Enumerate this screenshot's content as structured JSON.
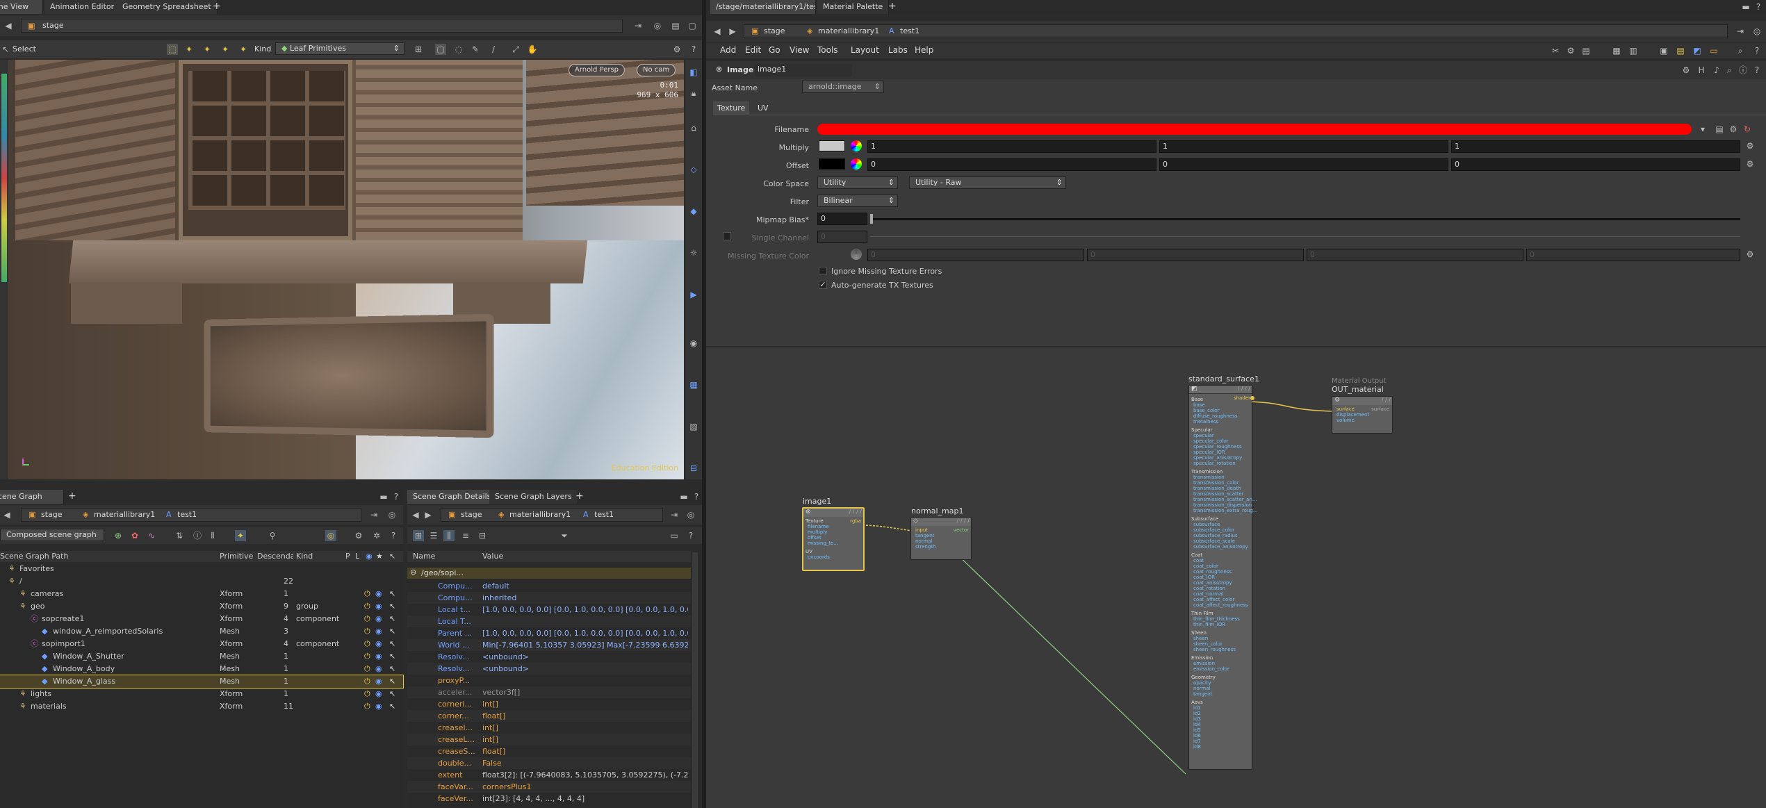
{
  "top_tabs_left": [
    "Scene View",
    "Animation Editor",
    "Geometry Spreadsheet"
  ],
  "top_tabs_right": [
    "/stage/materiallibrary1/test1",
    "Material Palette"
  ],
  "viewer": {
    "path": "stage",
    "tool_label": "Select",
    "kind_label": "Kind",
    "kind_value": "Leaf Primitives",
    "renderer": "Arnold Persp",
    "camera": "No cam",
    "time": "0:01",
    "resolution": "969 x 606",
    "watermark": "Education Edition"
  },
  "scene_tree": {
    "tab": "Scene Graph Tree",
    "breadcrumbs": [
      "stage",
      "materiallibrary1",
      "test1"
    ],
    "mode": "Composed scene graph",
    "columns": [
      "Scene Graph Path",
      "Primitive",
      "Descendants",
      "Kind",
      "P",
      "L",
      "V",
      "S"
    ],
    "rows": [
      {
        "name": "Favorites",
        "prim": "",
        "desc": "",
        "kind": "",
        "indent": 0
      },
      {
        "name": "/",
        "prim": "",
        "desc": "22",
        "kind": "",
        "indent": 0
      },
      {
        "name": "cameras",
        "prim": "Xform",
        "desc": "1",
        "kind": "",
        "indent": 1
      },
      {
        "name": "geo",
        "prim": "Xform",
        "desc": "9",
        "kind": "group",
        "indent": 1
      },
      {
        "name": "sopcreate1",
        "prim": "Xform",
        "desc": "4",
        "kind": "component",
        "indent": 2
      },
      {
        "name": "window_A_reimportedSolaris",
        "prim": "Mesh",
        "desc": "3",
        "kind": "",
        "indent": 3
      },
      {
        "name": "sopimport1",
        "prim": "Xform",
        "desc": "4",
        "kind": "component",
        "indent": 2
      },
      {
        "name": "Window_A_Shutter",
        "prim": "Mesh",
        "desc": "1",
        "kind": "",
        "indent": 3
      },
      {
        "name": "Window_A_body",
        "prim": "Mesh",
        "desc": "1",
        "kind": "",
        "indent": 3
      },
      {
        "name": "Window_A_glass",
        "prim": "Mesh",
        "desc": "1",
        "kind": "",
        "indent": 3
      },
      {
        "name": "lights",
        "prim": "Xform",
        "desc": "1",
        "kind": "",
        "indent": 1
      },
      {
        "name": "materials",
        "prim": "Xform",
        "desc": "11",
        "kind": "",
        "indent": 1
      }
    ]
  },
  "details": {
    "tabs": [
      "Scene Graph Details",
      "Scene Graph Layers"
    ],
    "breadcrumbs": [
      "stage",
      "materiallibrary1",
      "test1"
    ],
    "columns": [
      "Name",
      "Value"
    ],
    "path": "/geo/sopi...",
    "rows": [
      {
        "k": "Compu...",
        "v": "default",
        "c": "b"
      },
      {
        "k": "Compu...",
        "v": "inherited",
        "c": "b"
      },
      {
        "k": "Local t...",
        "v": "[1.0, 0.0, 0.0,  0.0] [0.0, 1.0, 0.0,  0.0] [0.0, 0.0, 1.0,  0.0...",
        "c": "b"
      },
      {
        "k": "Local T...",
        "v": "",
        "c": "b"
      },
      {
        "k": "Parent ...",
        "v": "[1.0, 0.0, 0.0,  0.0] [0.0, 1.0, 0.0,  0.0] [0.0, 0.0, 1.0,  0.0...",
        "c": "b"
      },
      {
        "k": "World ...",
        "v": "Min[-7.96401 5.10357 3.05923] Max[-7.23599 6.6392...",
        "c": "b"
      },
      {
        "k": "Resolv...",
        "v": "<unbound>",
        "c": "b"
      },
      {
        "k": "Resolv...",
        "v": "<unbound>",
        "c": "b"
      },
      {
        "k": "proxyP...",
        "v": "",
        "c": "o"
      },
      {
        "k": "acceler...",
        "v": "vector3f[]",
        "c": "g"
      },
      {
        "k": "corneri...",
        "v": "int[]",
        "c": "o"
      },
      {
        "k": "corner...",
        "v": "float[]",
        "c": "o"
      },
      {
        "k": "creaseI...",
        "v": "int[]",
        "c": "o"
      },
      {
        "k": "creaseL...",
        "v": "int[]",
        "c": "o"
      },
      {
        "k": "creaseS...",
        "v": "float[]",
        "c": "o"
      },
      {
        "k": "double...",
        "v": "False",
        "c": "o"
      },
      {
        "k": "extent",
        "v": "float3[2]: [(-7.9640083, 5.1035705, 3.0592275), (-7.23...",
        "c": "w"
      },
      {
        "k": "faceVar...",
        "v": "cornersPlus1",
        "c": "o"
      },
      {
        "k": "faceVer...",
        "v": "int[23]: [4, 4, 4, ..., 4, 4, 4]",
        "c": "w"
      }
    ]
  },
  "params": {
    "menus": [
      "Add",
      "Edit",
      "Go",
      "View",
      "Tools",
      "Layout",
      "Labs",
      "Help"
    ],
    "breadcrumbs": [
      "stage",
      "materiallibrary1",
      "test1"
    ],
    "node_type": "Image",
    "node_name": "image1",
    "asset_name_label": "Asset Name",
    "asset_name_value": "arnold::image",
    "tabs": [
      "Texture",
      "UV"
    ],
    "filename_label": "Filename",
    "multiply_label": "Multiply",
    "multiply_values": [
      "1",
      "1",
      "1"
    ],
    "offset_label": "Offset",
    "offset_values": [
      "0",
      "0",
      "0"
    ],
    "color_space_label": "Color Space",
    "color_space_values": [
      "Utility",
      "Utility - Raw"
    ],
    "filter_label": "Filter",
    "filter_value": "Bilinear",
    "mipmap_label": "Mipmap Bias*",
    "mipmap_value": "0",
    "single_channel_label": "Single Channel",
    "single_channel_value": "0",
    "missing_texture_label": "Missing Texture Color",
    "missing_texture_values": [
      "0",
      "0",
      "0",
      "0"
    ],
    "ignore_label": "Ignore Missing Texture Errors",
    "autotx_label": "Auto-generate TX Textures"
  },
  "network": {
    "nodes": {
      "standard_surface": "standard_surface1",
      "material_output_type": "Material Output",
      "material_output": "OUT_material",
      "image": "image1",
      "normal_map": "normal_map1"
    },
    "std_out": "shader",
    "out_inputs": [
      "surface",
      "displacement",
      "volume"
    ],
    "out_output": "surface",
    "image_inputs": [
      "Texture",
      "filename",
      "multiply",
      "offset",
      "missing_te...",
      "UV",
      "uvcoords"
    ],
    "image_output": "rgba",
    "normal_inputs": [
      "input",
      "tangent",
      "normal",
      "strength"
    ],
    "normal_output": "vector",
    "std_sections": [
      {
        "title": "Base",
        "ports": [
          "base",
          "base_color",
          "diffuse_roughness",
          "metalness"
        ]
      },
      {
        "title": "Specular",
        "ports": [
          "specular",
          "specular_color",
          "specular_roughness",
          "specular_IOR",
          "specular_anisotropy",
          "specular_rotation"
        ]
      },
      {
        "title": "Transmission",
        "ports": [
          "transmission",
          "transmission_color",
          "transmission_depth",
          "transmission_scatter",
          "transmission_scatter_an...",
          "transmission_dispersion",
          "transmission_extra_roug..."
        ]
      },
      {
        "title": "Subsurface",
        "ports": [
          "subsurface",
          "subsurface_color",
          "subsurface_radius",
          "subsurface_scale",
          "subsurface_anisotropy"
        ]
      },
      {
        "title": "Coat",
        "ports": [
          "coat",
          "coat_color",
          "coat_roughness",
          "coat_IOR",
          "coat_anisotropy",
          "coat_rotation",
          "coat_normal",
          "coat_affect_color",
          "coat_affect_roughness"
        ]
      },
      {
        "title": "Thin Film",
        "ports": [
          "thin_film_thickness",
          "thin_film_IOR"
        ]
      },
      {
        "title": "Sheen",
        "ports": [
          "sheen",
          "sheen_color",
          "sheen_roughness"
        ]
      },
      {
        "title": "Emission",
        "ports": [
          "emission",
          "emission_color"
        ]
      },
      {
        "title": "Geometry",
        "ports": [
          "opacity",
          "normal",
          "tangent"
        ]
      },
      {
        "title": "Aovs",
        "ports": [
          "id1",
          "id2",
          "id3",
          "id4",
          "id5",
          "id6",
          "id7",
          "id8"
        ]
      }
    ]
  },
  "colors": {
    "accent": "#e6c64a",
    "filename_bar": "#ff0000",
    "port": "#6fc0ff",
    "wire": "#8fd080"
  }
}
